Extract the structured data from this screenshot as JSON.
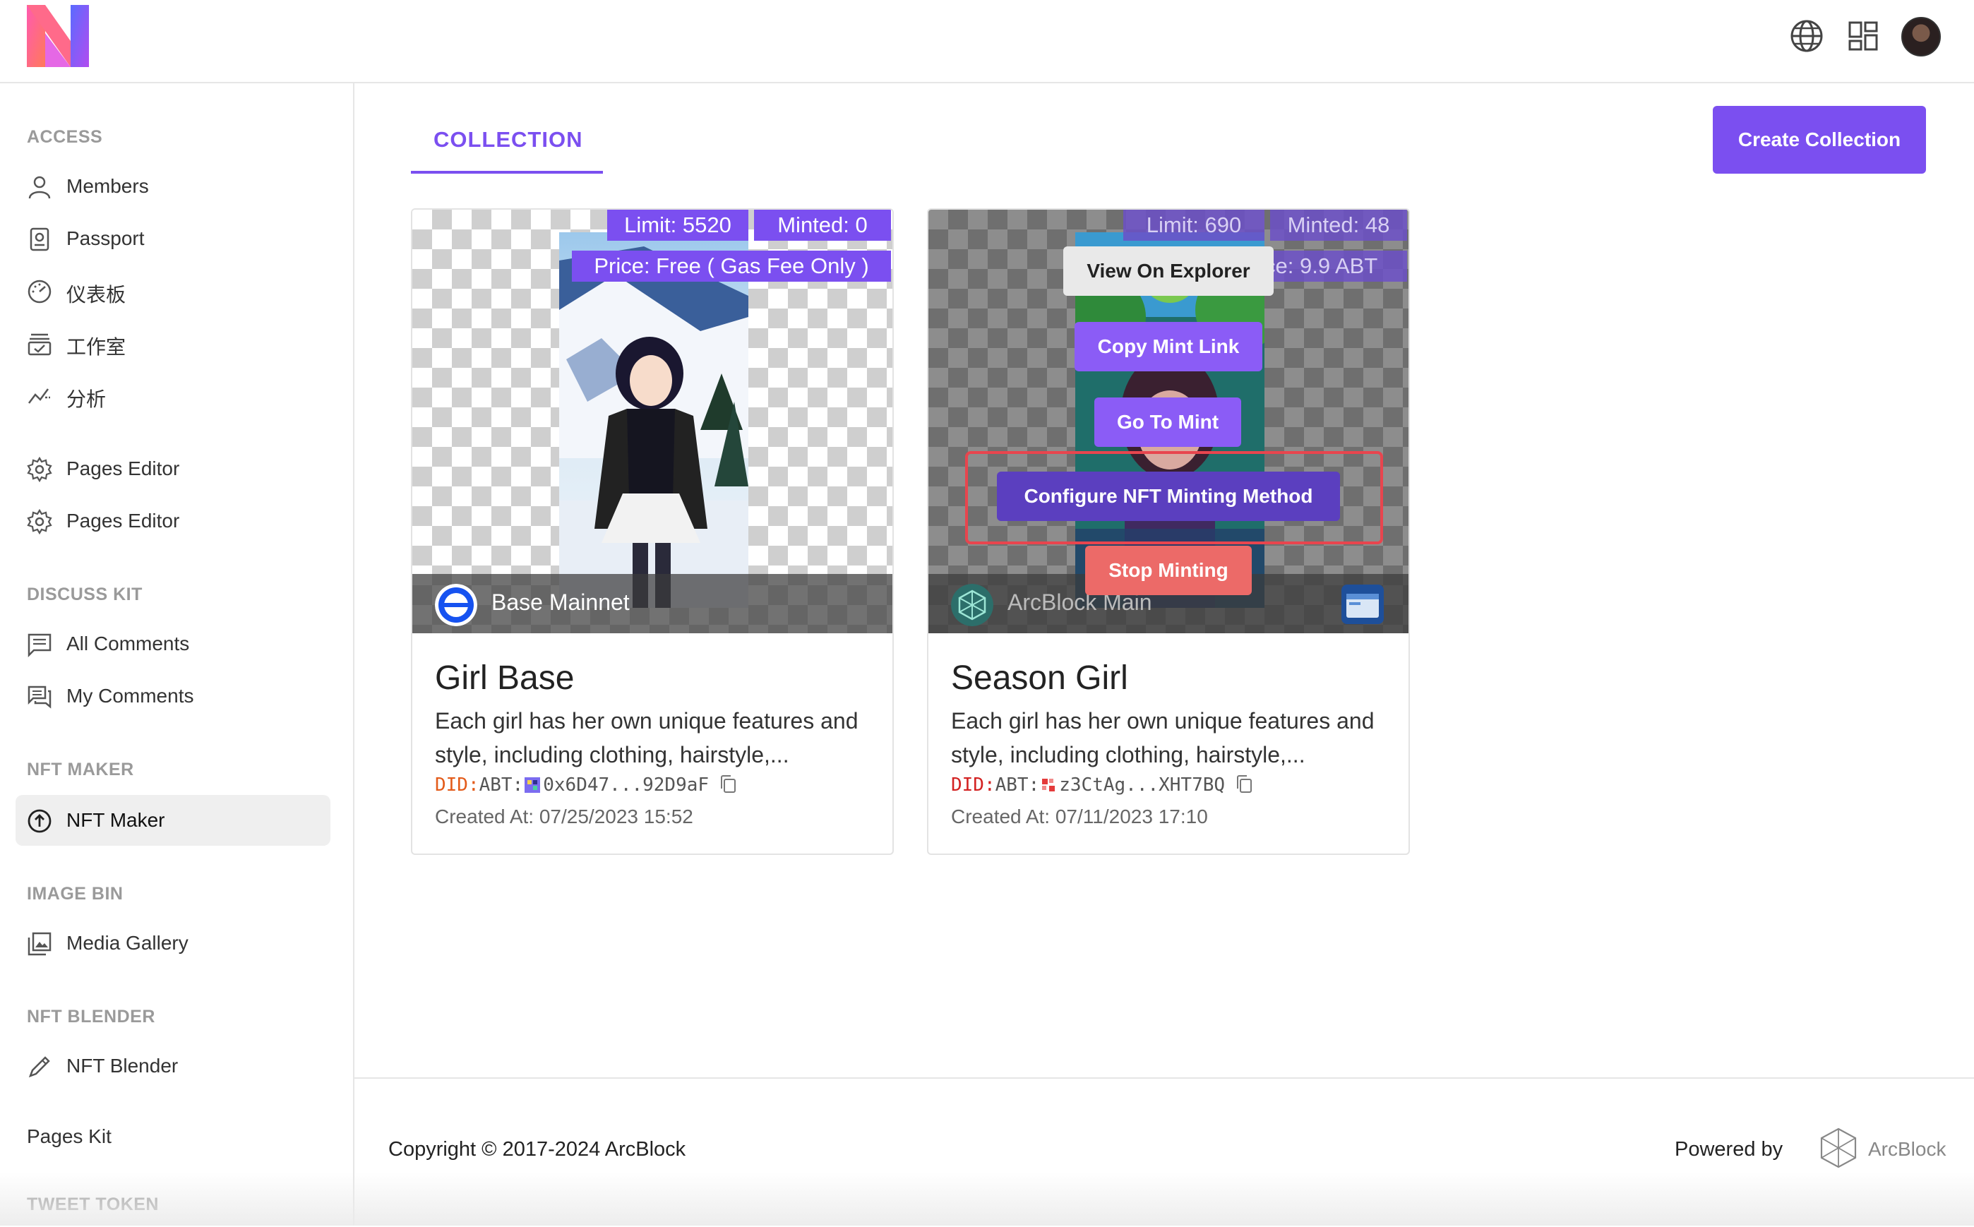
{
  "header": {
    "logo": "n-logo",
    "icons": [
      "globe-icon",
      "grid-icon",
      "avatar"
    ]
  },
  "sidebar": {
    "sections": {
      "access": "ACCESS",
      "discuss_kit": "DISCUSS KIT",
      "nft_maker": "NFT MAKER",
      "image_bin": "IMAGE BIN",
      "nft_blender": "NFT BLENDER",
      "tweet_token": "TWEET TOKEN"
    },
    "items": [
      {
        "label": "Members",
        "icon": "user-icon"
      },
      {
        "label": "Passport",
        "icon": "passport-icon"
      },
      {
        "label": "仪表板",
        "icon": "dashboard-icon"
      },
      {
        "label": "工作室",
        "icon": "studio-icon"
      },
      {
        "label": "分析",
        "icon": "analytics-icon"
      },
      {
        "label": "Pages Editor",
        "icon": "gear-icon"
      },
      {
        "label": "Pages Editor",
        "icon": "gear-icon"
      },
      {
        "label": "All Comments",
        "icon": "comment-icon"
      },
      {
        "label": "My Comments",
        "icon": "comments-icon"
      },
      {
        "label": "NFT Maker",
        "icon": "upload-circle-icon",
        "active": true
      },
      {
        "label": "Media Gallery",
        "icon": "gallery-icon"
      },
      {
        "label": "NFT Blender",
        "icon": "pencil-icon"
      }
    ],
    "pages_kit": "Pages Kit"
  },
  "main": {
    "tab_label": "COLLECTION",
    "create_button": "Create Collection",
    "accent": "#7b4ff0"
  },
  "cards": [
    {
      "limit": "Limit: 5520",
      "minted": "Minted: 0",
      "price": "Price: Free ( Gas Fee Only )",
      "chain": "Base Mainnet",
      "title": "Girl Base",
      "desc": "Each girl has her own unique features and style, including clothing, hairstyle,...",
      "did_prefix": "DID:",
      "did_type": "ABT:",
      "did_value": "0x6D47...92D9aF",
      "created": "Created At: 07/25/2023 15:52"
    },
    {
      "limit": "Limit: 690",
      "minted": "Minted: 48",
      "price": "ce: 9.9 ABT",
      "chain": "ArcBlock Main",
      "title": "Season Girl",
      "desc": "Each girl has her own unique features and style, including clothing, hairstyle,...",
      "did_prefix": "DID:",
      "did_type": "ABT:",
      "did_value": "z3CtAg...XHT7BQ",
      "created": "Created At: 07/11/2023 17:10"
    }
  ],
  "card_menu": {
    "view_explorer": "View On Explorer",
    "copy_mint_link": "Copy Mint Link",
    "go_to_mint": "Go To Mint",
    "configure": "Configure NFT Minting Method",
    "stop_minting": "Stop Minting"
  },
  "footer": {
    "copyright": "Copyright © 2017-2024  ArcBlock",
    "powered_by": "Powered by",
    "brand": "ArcBlock"
  }
}
